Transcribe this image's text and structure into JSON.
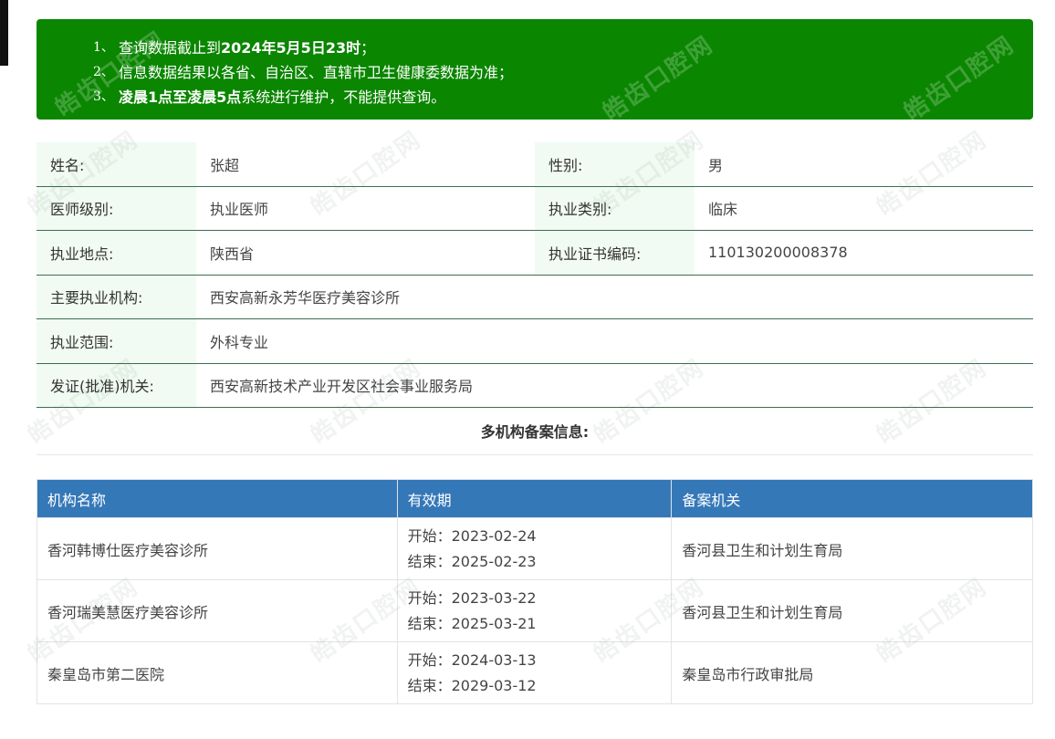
{
  "notice": {
    "items": [
      {
        "num": "1、",
        "text_before": "查询数据截止到",
        "bold": "2024年5月5日23时",
        "text_after": "；"
      },
      {
        "num": "2、",
        "text_before": "信息数据结果以各省、自治区、直辖市卫生健康委数据为准；",
        "bold": "",
        "text_after": ""
      },
      {
        "num": "3、",
        "text_before": "",
        "bold": "凌晨1点至凌晨5点",
        "text_after": "系统进行维护，不能提供查询。"
      }
    ]
  },
  "profile": {
    "name_label": "姓名:",
    "name_value": "张超",
    "gender_label": "性别:",
    "gender_value": "男",
    "level_label": "医师级别:",
    "level_value": "执业医师",
    "category_label": "执业类别:",
    "category_value": "临床",
    "location_label": "执业地点:",
    "location_value": "陕西省",
    "cert_label": "执业证书编码:",
    "cert_value": "110130200008378",
    "org_label": "主要执业机构:",
    "org_value": "西安高新永芳华医疗美容诊所",
    "scope_label": "执业范围:",
    "scope_value": "外科专业",
    "issuer_label": "发证(批准)机关:",
    "issuer_value": "西安高新技术产业开发区社会事业服务局"
  },
  "multi": {
    "title": "多机构备案信息:",
    "headers": [
      "机构名称",
      "有效期",
      "备案机关"
    ],
    "rows": [
      {
        "org": "香河韩博仕医疗美容诊所",
        "start": "开始：2023-02-24",
        "end": "结束：2025-02-23",
        "authority": "香河县卫生和计划生育局"
      },
      {
        "org": "香河瑞美慧医疗美容诊所",
        "start": "开始：2023-03-22",
        "end": "结束：2025-03-21",
        "authority": "香河县卫生和计划生育局"
      },
      {
        "org": "秦皇岛市第二医院",
        "start": "开始：2024-03-13",
        "end": "结束：2029-03-12",
        "authority": "秦皇岛市行政审批局"
      }
    ]
  },
  "watermark": "皓齿口腔网",
  "colors": {
    "banner": "#0a8600",
    "table_header": "#3578b8",
    "label_bg": "#f1fbf3"
  }
}
